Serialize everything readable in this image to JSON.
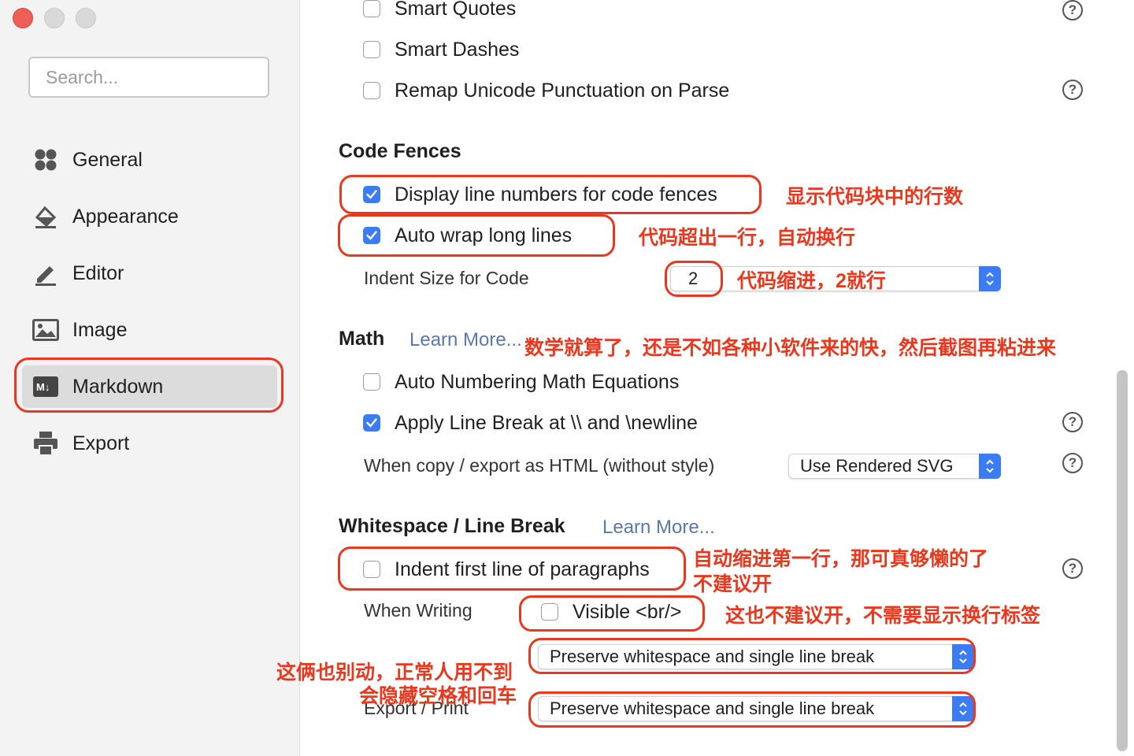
{
  "sidebar": {
    "search_placeholder": "Search...",
    "items": [
      {
        "label": "General",
        "icon": "grid-icon"
      },
      {
        "label": "Appearance",
        "icon": "paint-bucket-icon"
      },
      {
        "label": "Editor",
        "icon": "pencil-icon"
      },
      {
        "label": "Image",
        "icon": "image-icon"
      },
      {
        "label": "Markdown",
        "icon": "markdown-icon",
        "selected": true
      },
      {
        "label": "Export",
        "icon": "printer-icon"
      }
    ]
  },
  "top_options": [
    {
      "label": "Smart Quotes",
      "checked": false
    },
    {
      "label": "Smart Dashes",
      "checked": false
    },
    {
      "label": "Remap Unicode Punctuation on Parse",
      "checked": false
    }
  ],
  "code_fences": {
    "title": "Code Fences",
    "display_line_numbers": "Display line numbers for code fences",
    "auto_wrap": "Auto wrap long lines",
    "indent_label": "Indent Size for Code",
    "indent_value": "2"
  },
  "math": {
    "title": "Math",
    "learn_more": "Learn More...",
    "auto_numbering": "Auto Numbering Math Equations",
    "apply_line_break": "Apply Line Break at \\\\ and \\newline",
    "copy_export_label": "When copy / export as HTML (without style)",
    "copy_export_value": "Use Rendered SVG"
  },
  "whitespace": {
    "title": "Whitespace / Line Break",
    "learn_more": "Learn More...",
    "indent_first_line": "Indent first line of paragraphs",
    "when_writing": "When Writing",
    "visible_br": "Visible <br/>",
    "writing_select": "Preserve whitespace and single line break",
    "export_label": "Export / Print",
    "export_select": "Preserve whitespace and single line break"
  },
  "annotations": {
    "line_numbers": "显示代码块中的行数",
    "wrap": "代码超出一行，自动换行",
    "indent": "代码缩进，2就行",
    "math": "数学就算了，还是不如各种小软件来的快，然后截图再粘进来",
    "indent_first_1": "自动缩进第一行，那可真够懒的了",
    "indent_first_2": "不建议开",
    "visible_br": "这也不建议开，不需要显示换行标签",
    "whitespace_1": "这俩也别动，正常人用不到",
    "whitespace_2": "会隐藏空格和回车"
  },
  "colors": {
    "accent": "#3b7cf4",
    "annotation": "#e8391f"
  }
}
